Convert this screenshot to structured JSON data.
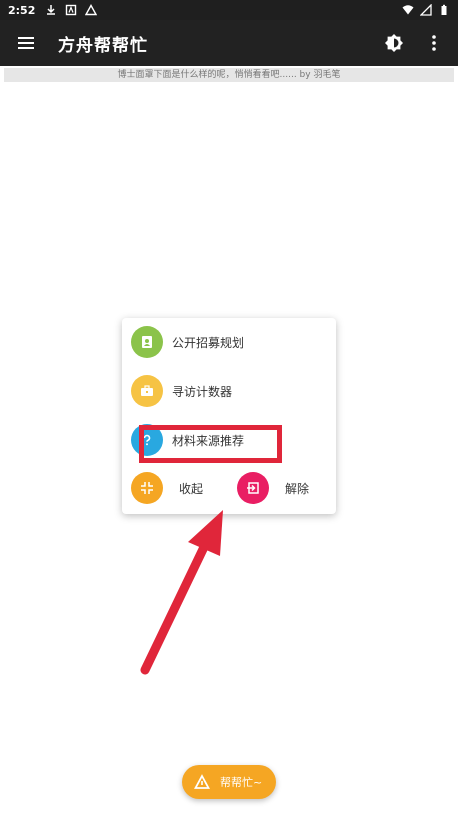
{
  "status_bar": {
    "time": "2:52"
  },
  "app_bar": {
    "title": "方舟帮帮忙"
  },
  "tip": {
    "text": "博士面罩下面是什么样的呢，悄悄看看吧...... by 羽毛笔"
  },
  "popup_menu": {
    "items": [
      {
        "label": "公开招募规划",
        "icon": "recruit-badge-icon",
        "color": "#8bc34a"
      },
      {
        "label": "寻访计数器",
        "icon": "briefcase-icon",
        "color": "#f6c344"
      },
      {
        "label": "材料来源推荐",
        "icon": "help-circle-icon",
        "color": "#29a8e0"
      }
    ],
    "collapse": {
      "label": "收起",
      "icon": "collapse-icon",
      "color": "#f5a623"
    },
    "dismiss": {
      "label": "解除",
      "icon": "exit-icon",
      "color": "#e91e63"
    }
  },
  "fab": {
    "label": "帮帮忙~",
    "icon": "triangle-logo-icon",
    "color": "#f5a623"
  },
  "annotation": {
    "box_color": "#e0263a",
    "arrow_color": "#e0263a"
  }
}
